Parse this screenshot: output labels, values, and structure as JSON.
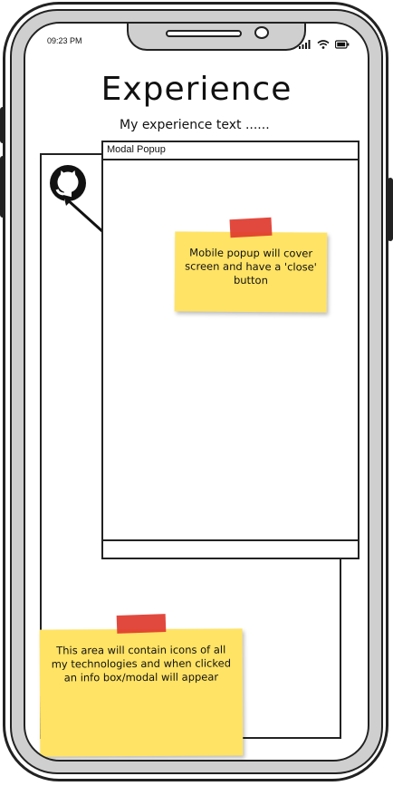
{
  "status_bar": {
    "time": "09:23 PM",
    "icons": [
      "signal-icon",
      "wifi-icon",
      "battery-icon"
    ]
  },
  "page": {
    "title": "Experience",
    "subtitle": "My experience text ......"
  },
  "content_area": {
    "icon": "github-icon"
  },
  "modal": {
    "title": "Modal Popup"
  },
  "notes": {
    "modal_note": "Mobile popup will cover screen and have a 'close' button",
    "icons_note": "This area will contain icons of all my technologies and when clicked an info box/modal will appear"
  },
  "colors": {
    "sticky": "#ffe365",
    "tape": "#e03a2e",
    "bezel": "#cfcfcf",
    "outline": "#222222"
  }
}
